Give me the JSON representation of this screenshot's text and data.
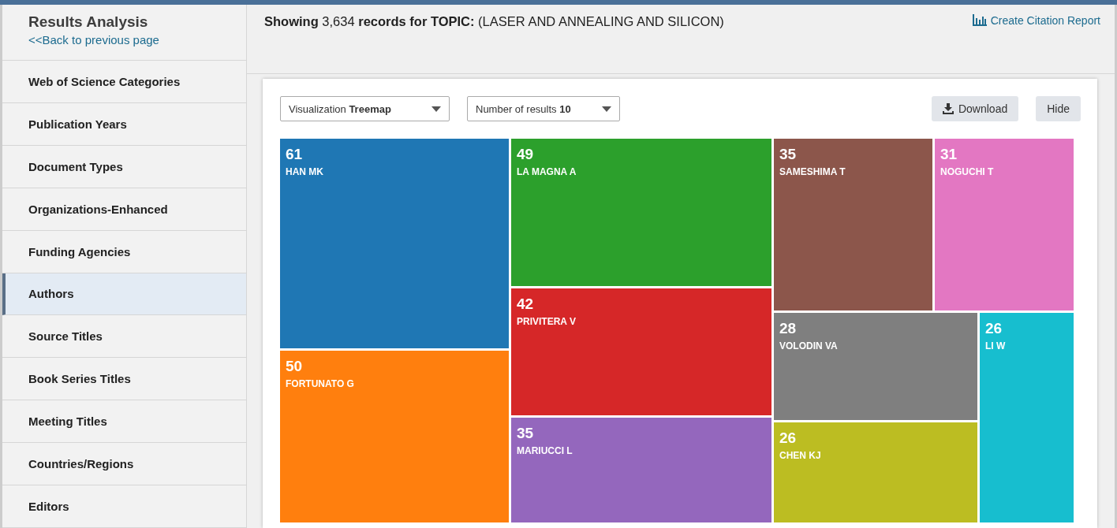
{
  "sidebar": {
    "title": "Results Analysis",
    "back_link": "<<Back to previous page",
    "items": [
      {
        "label": "Web of Science Categories",
        "selected": false
      },
      {
        "label": "Publication Years",
        "selected": false
      },
      {
        "label": "Document Types",
        "selected": false
      },
      {
        "label": "Organizations-Enhanced",
        "selected": false
      },
      {
        "label": "Funding Agencies",
        "selected": false
      },
      {
        "label": "Authors",
        "selected": true
      },
      {
        "label": "Source Titles",
        "selected": false
      },
      {
        "label": "Book Series Titles",
        "selected": false
      },
      {
        "label": "Meeting Titles",
        "selected": false
      },
      {
        "label": "Countries/Regions",
        "selected": false
      },
      {
        "label": "Editors",
        "selected": false
      }
    ]
  },
  "header": {
    "summary": "**Showing** 3,634 **records for TOPIC:** (LASER AND ANNEALING AND SILICON)",
    "citation_report": "Create Citation Report"
  },
  "controls": {
    "visualization": {
      "label": "Visualization",
      "value": "Treemap"
    },
    "results": {
      "label": "Number of results",
      "value": "10"
    },
    "download": "Download",
    "hide": "Hide"
  },
  "treemap": [
    {
      "value": "61",
      "label": "HAN MK",
      "color": "#1f77b4"
    },
    {
      "value": "50",
      "label": "FORTUNATO G",
      "color": "#ff7f0e"
    },
    {
      "value": "49",
      "label": "LA MAGNA A",
      "color": "#2ca02c"
    },
    {
      "value": "42",
      "label": "PRIVITERA V",
      "color": "#d62728"
    },
    {
      "value": "35",
      "label": "MARIUCCI L",
      "color": "#9467bd"
    },
    {
      "value": "35",
      "label": "SAMESHIMA T",
      "color": "#8c564b"
    },
    {
      "value": "31",
      "label": "NOGUCHI T",
      "color": "#e377c2"
    },
    {
      "value": "28",
      "label": "VOLODIN VA",
      "color": "#7f7f7f"
    },
    {
      "value": "26",
      "label": "CHEN KJ",
      "color": "#bcbd22"
    },
    {
      "value": "26",
      "label": "LI W",
      "color": "#17becf"
    }
  ]
}
